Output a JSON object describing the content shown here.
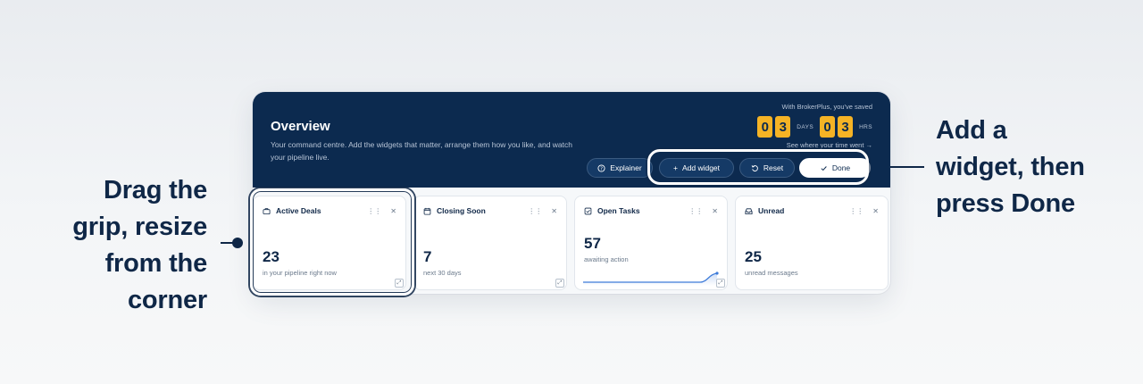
{
  "annotations": {
    "left": [
      "Drag the",
      "grip, resize",
      "from the",
      "corner"
    ],
    "right": [
      "Add a",
      "widget, then",
      "press Done"
    ]
  },
  "banner": {
    "title": "Overview",
    "description": "Your command centre. Add the widgets that matter, arrange them how you like, and watch your pipeline live.",
    "saved_label": "With BrokerPlus, you've saved",
    "days_digits": [
      "0",
      "3"
    ],
    "days_unit": "DAYS",
    "hrs_digits": [
      "0",
      "3"
    ],
    "hrs_unit": "HRS",
    "see_link": "See where your time went →",
    "accent_color": "#f5b325",
    "background_color": "#0c2a4f"
  },
  "toolbar": {
    "explainer": "Explainer",
    "add_widget": "Add widget",
    "reset": "Reset",
    "done": "Done"
  },
  "widgets": [
    {
      "title": "Active Deals",
      "icon": "briefcase-icon",
      "value": "23",
      "sub": "in your pipeline right now"
    },
    {
      "title": "Closing Soon",
      "icon": "calendar-icon",
      "value": "7",
      "sub": "next 30 days"
    },
    {
      "title": "Open Tasks",
      "icon": "checkbox-icon",
      "value": "57",
      "sub": "awaiting action"
    },
    {
      "title": "Unread",
      "icon": "inbox-icon",
      "value": "25",
      "sub": "unread messages"
    }
  ]
}
